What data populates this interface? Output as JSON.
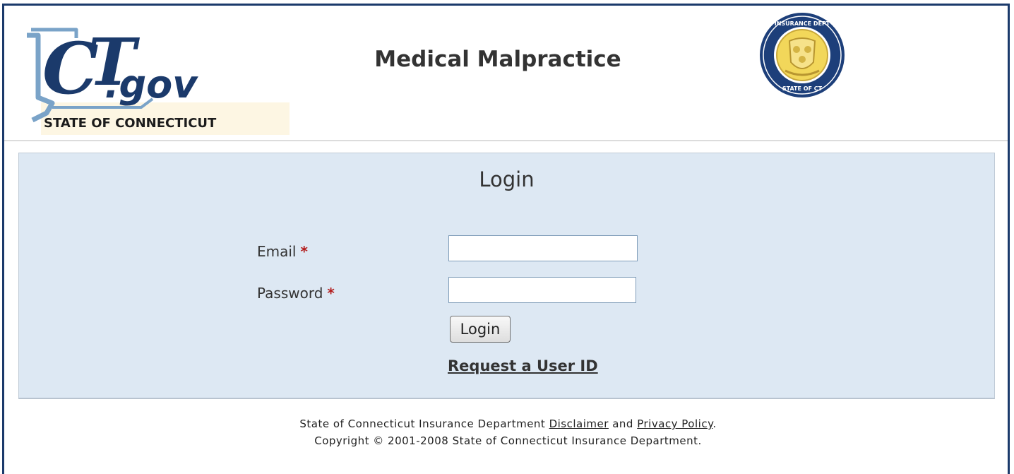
{
  "header": {
    "logo_text": "CT.gov",
    "logo_subtitle": "STATE OF CONNECTICUT",
    "title": "Medical Malpractice",
    "seal_text": "INSURANCE DEPARTMENT · STATE OF CONNECTICUT"
  },
  "login": {
    "title": "Login",
    "email_label": "Email",
    "password_label": "Password",
    "required_marker": "*",
    "email_value": "",
    "password_value": "",
    "button_label": "Login",
    "request_link": "Request a User ID"
  },
  "footer": {
    "line1_prefix": "State of Connecticut Insurance Department",
    "disclaimer_link": "Disclaimer",
    "and_text": "and",
    "privacy_link": "Privacy Policy",
    "period": ".",
    "copyright": "Copyright © 2001-2008 State of Connecticut Insurance Department."
  },
  "colors": {
    "border": "#1b3a6b",
    "panel_bg": "#dde8f3",
    "required": "#b31b1b",
    "seal_gold": "#f2d75a",
    "logo_blue": "#1b3a6b"
  }
}
